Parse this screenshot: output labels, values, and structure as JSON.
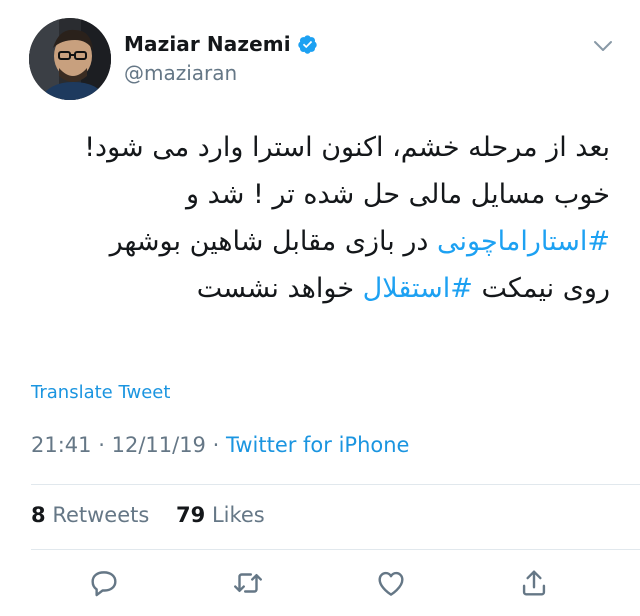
{
  "author": {
    "display_name": "Maziar Nazemi",
    "handle": "@maziaran",
    "verified": true
  },
  "tweet": {
    "lines": [
      [
        {
          "text": "بعد از مرحله خشم، اکنون استرا  وارد می شود!",
          "hashtag": false
        }
      ],
      [
        {
          "text": "خوب مسایل مالی حل شده تر ! شد و",
          "hashtag": false
        }
      ],
      [
        {
          "text": "#استاراماچونی",
          "hashtag": true
        },
        {
          "text": " در بازی مقابل شاهین بوشهر",
          "hashtag": false
        }
      ],
      [
        {
          "text": "روی نیمکت ",
          "hashtag": false
        },
        {
          "text": "#استقلال",
          "hashtag": true
        },
        {
          "text": " خواهد نشست",
          "hashtag": false
        }
      ]
    ],
    "translate_label": "Translate Tweet",
    "time": "21:41",
    "date": "12/11/19",
    "separator": "·",
    "source": "Twitter for iPhone"
  },
  "stats": {
    "retweets_count": "8",
    "retweets_label": "Retweets",
    "likes_count": "79",
    "likes_label": "Likes"
  },
  "colors": {
    "accent": "#1da1f2",
    "link": "#1b95e0",
    "secondary_text": "#657786",
    "primary_text": "#14171a",
    "divider": "#e1e8ed"
  },
  "actions": [
    {
      "name": "reply-icon"
    },
    {
      "name": "retweet-icon"
    },
    {
      "name": "like-icon"
    },
    {
      "name": "share-icon"
    }
  ]
}
